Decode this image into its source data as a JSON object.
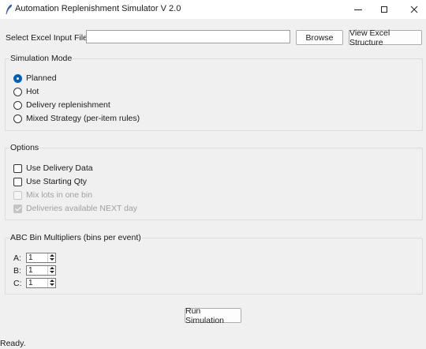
{
  "window": {
    "title": "Automation Replenishment Simulator V 2.0"
  },
  "file": {
    "label": "Select Excel Input File:",
    "value": "",
    "browse_label": "Browse",
    "view_structure_label": "View Excel Structure"
  },
  "simulation_mode": {
    "title": "Simulation Mode",
    "options": [
      {
        "label": "Planned",
        "selected": true
      },
      {
        "label": "Hot",
        "selected": false
      },
      {
        "label": "Delivery replenishment",
        "selected": false
      },
      {
        "label": "Mixed Strategy (per-item rules)",
        "selected": false
      }
    ]
  },
  "options": {
    "title": "Options",
    "items": [
      {
        "label": "Use Delivery Data",
        "checked": false,
        "enabled": true
      },
      {
        "label": "Use Starting Qty",
        "checked": false,
        "enabled": true
      },
      {
        "label": "Mix lots in one bin",
        "checked": false,
        "enabled": false
      },
      {
        "label": "Deliveries available NEXT day",
        "checked": true,
        "enabled": false
      }
    ]
  },
  "abc": {
    "title": "ABC Bin Multipliers (bins per event)",
    "rows": [
      {
        "label": "A:",
        "value": "1"
      },
      {
        "label": "B:",
        "value": "1"
      },
      {
        "label": "C:",
        "value": "1"
      }
    ]
  },
  "run_label": "Run Simulation",
  "status": "Ready.",
  "colors": {
    "accent": "#005fb8",
    "window_bg": "#f0f0f0"
  }
}
